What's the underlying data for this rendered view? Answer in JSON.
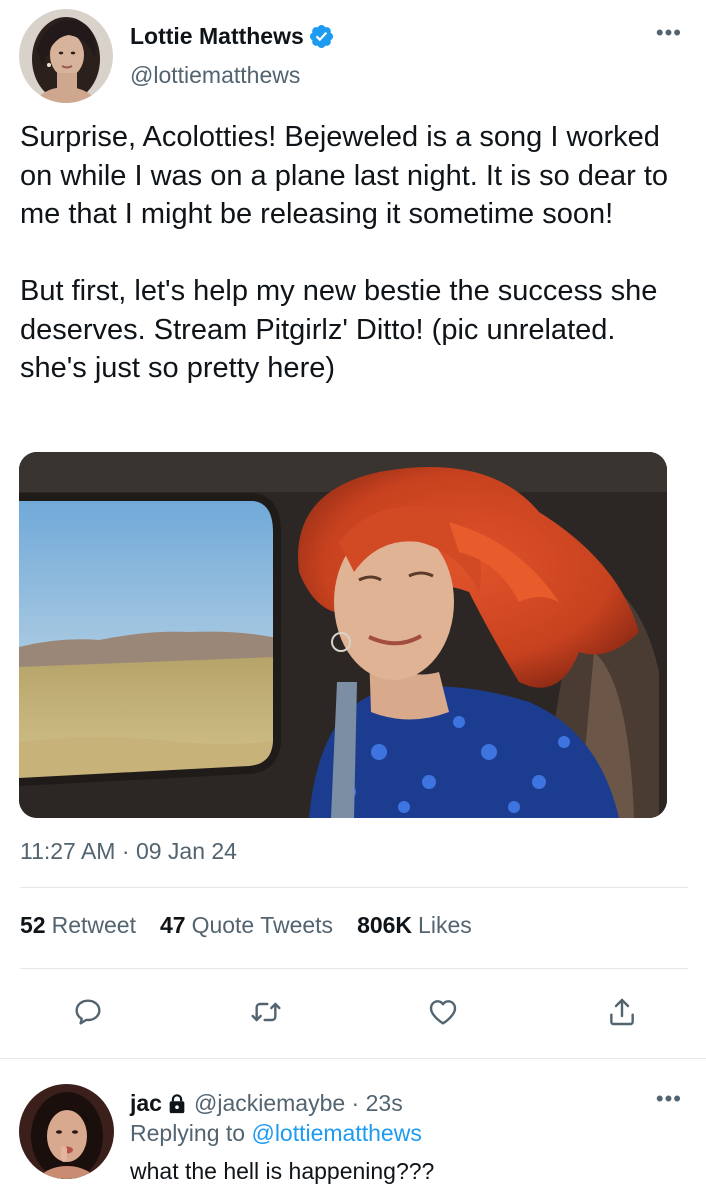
{
  "tweet": {
    "author": {
      "display_name": "Lottie Matthews",
      "handle": "@lottiematthews",
      "verified": true,
      "avatar_icon": "profile-photo"
    },
    "more_icon": "more-horizontal-icon",
    "text": "Surprise, Acolotties! Bejeweled is a song I worked on while I was on a plane last night. It is so dear to me that I might be releasing it sometime soon!\n\nBut first, let's help my new bestie the success she deserves. Stream Pitgirlz' Ditto! (pic unrelated. she's just so pretty here)",
    "media": {
      "type": "photo",
      "subject": "red-haired woman smiling in a car, desert landscape through the window"
    },
    "time": "11:27 AM",
    "date": "09 Jan 24",
    "stats": {
      "retweets_count": "52",
      "retweets_label": "Retweet",
      "quotes_count": "47",
      "quotes_label": "Quote Tweets",
      "likes_count": "806K",
      "likes_label": "Likes"
    },
    "actions": [
      {
        "name": "reply",
        "icon": "comment-icon"
      },
      {
        "name": "retweet",
        "icon": "retweet-icon"
      },
      {
        "name": "like",
        "icon": "heart-icon"
      },
      {
        "name": "share",
        "icon": "share-icon"
      }
    ]
  },
  "reply": {
    "display_name": "jac",
    "protected": true,
    "handle": "@jackiemaybe",
    "time_sep": " · ",
    "time": "23s",
    "replying_prefix": "Replying to",
    "replying_to": "@lottiematthews",
    "text": "what the hell is happening???"
  },
  "colors": {
    "text_primary": "#0f1419",
    "text_secondary": "#536471",
    "accent": "#1d9bf0",
    "divider": "#e4e8eb"
  }
}
